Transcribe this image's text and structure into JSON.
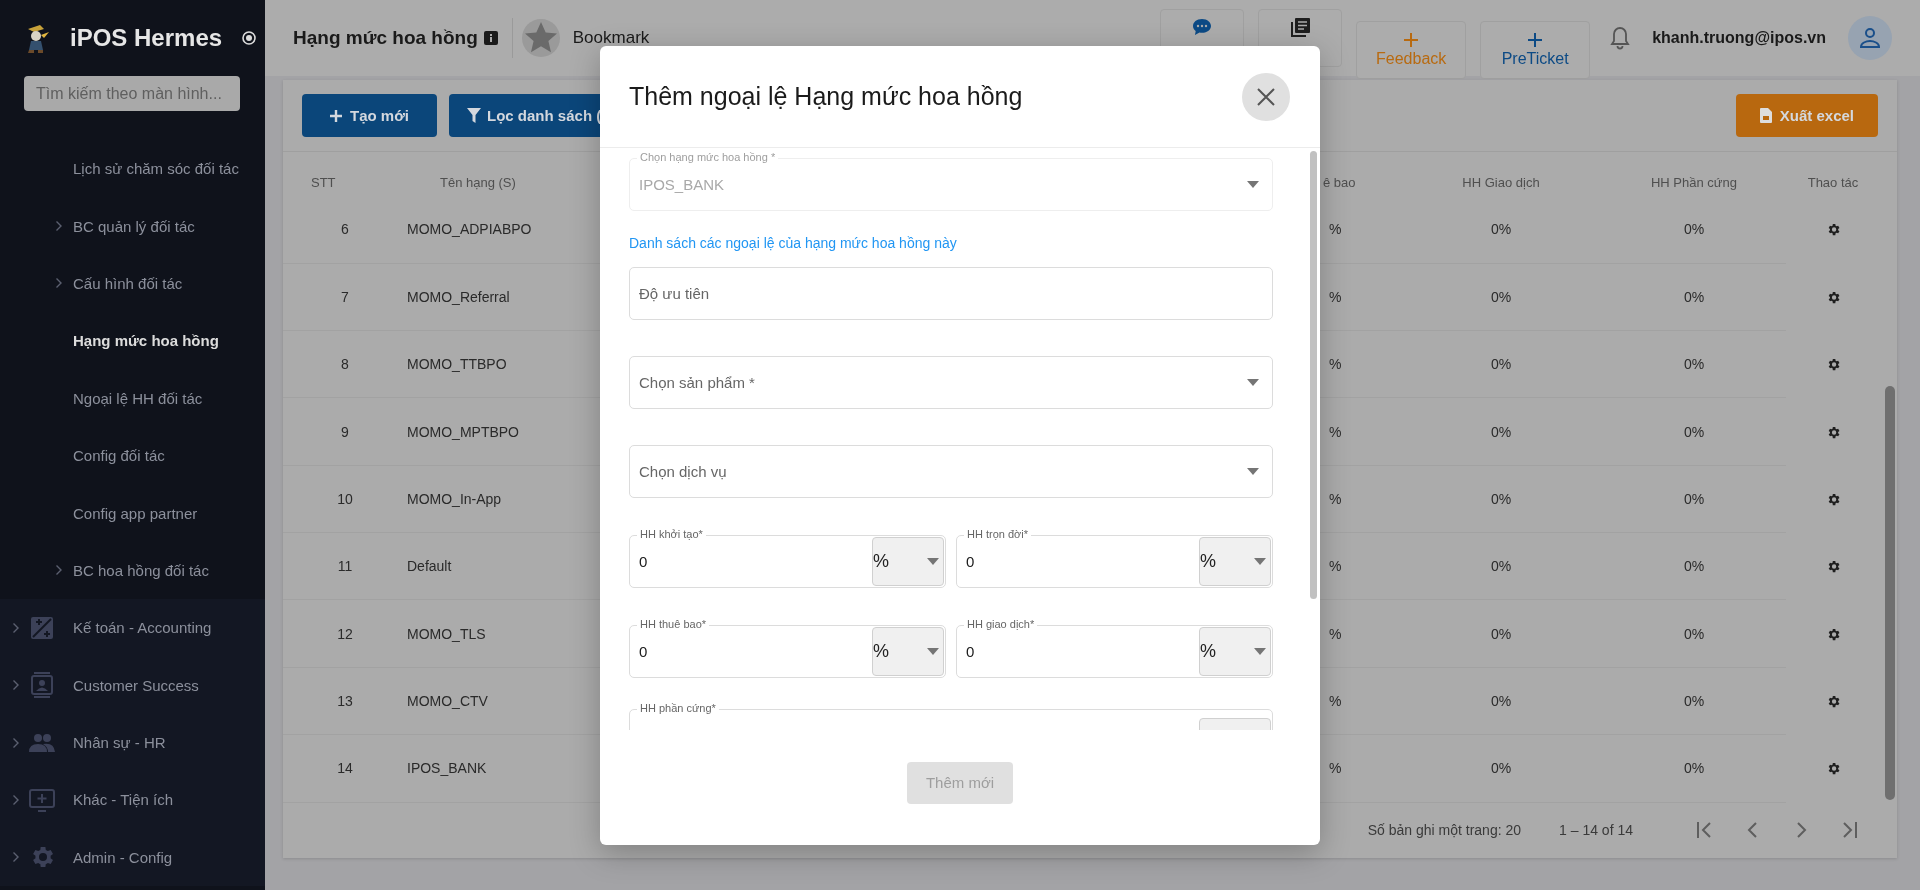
{
  "sidebar": {
    "brand": "iPOS Hermes",
    "search": {
      "placeholder": "Tìm kiếm theo màn hình..."
    },
    "items": [
      {
        "label": "Lịch sử chăm sóc đối tác",
        "kind": "sub",
        "expandable": false,
        "selected": false
      },
      {
        "label": "BC quản lý đối tác",
        "kind": "sub",
        "expandable": true,
        "selected": false
      },
      {
        "label": "Cấu hình đối tác",
        "kind": "sub",
        "expandable": true,
        "selected": false
      },
      {
        "label": "Hạng mức hoa hồng",
        "kind": "sub",
        "expandable": false,
        "selected": true
      },
      {
        "label": "Ngoại lệ HH đối tác",
        "kind": "sub",
        "expandable": false,
        "selected": false
      },
      {
        "label": "Config đối tác",
        "kind": "sub",
        "expandable": false,
        "selected": false
      },
      {
        "label": "Config app partner",
        "kind": "sub",
        "expandable": false,
        "selected": false
      },
      {
        "label": "BC hoa hồng đối tác",
        "kind": "sub",
        "expandable": true,
        "selected": false
      },
      {
        "label": "Kế toán - Accounting",
        "kind": "group",
        "expandable": true,
        "selected": false
      },
      {
        "label": "Customer Success",
        "kind": "group",
        "expandable": true,
        "selected": false
      },
      {
        "label": "Nhân sự - HR",
        "kind": "group",
        "expandable": true,
        "selected": false
      },
      {
        "label": "Khác - Tiện ích",
        "kind": "group",
        "expandable": true,
        "selected": false
      },
      {
        "label": "Admin - Config",
        "kind": "group",
        "expandable": true,
        "selected": false
      }
    ]
  },
  "topbar": {
    "title": "Hạng mức hoa hồng",
    "bookmark": "Bookmark",
    "actions": [
      {
        "color": "#0c4a85"
      },
      {
        "color": "#1e1e1e"
      },
      {
        "label": "Feedback",
        "color": "#b86a10"
      },
      {
        "label": "PreTicket",
        "color": "#0c4a85"
      }
    ],
    "user": "khanh.truong@ipos.vn"
  },
  "toolbar": {
    "create": "Tạo mới",
    "filter": "Lọc danh sách (",
    "export": "Xuất excel"
  },
  "table": {
    "columns": [
      "STT",
      "Tên hạng (S)",
      "ê bao",
      "HH Giao dịch",
      "HH Phần cứng",
      "Thao tác"
    ],
    "rows": [
      [
        "6",
        "MOMO_ADPIABPO",
        "%",
        "0%",
        "0%"
      ],
      [
        "7",
        "MOMO_Referral",
        "%",
        "0%",
        "0%"
      ],
      [
        "8",
        "MOMO_TTBPO",
        "%",
        "0%",
        "0%"
      ],
      [
        "9",
        "MOMO_MPTBPO",
        "%",
        "0%",
        "0%"
      ],
      [
        "10",
        "MOMO_In-App",
        "%",
        "0%",
        "0%"
      ],
      [
        "11",
        "Default",
        "%",
        "0%",
        "0%"
      ],
      [
        "12",
        "MOMO_TLS",
        "%",
        "0%",
        "0%"
      ],
      [
        "13",
        "MOMO_CTV",
        "%",
        "0%",
        "0%"
      ],
      [
        "14",
        "IPOS_BANK",
        "%",
        "0%",
        "0%"
      ]
    ]
  },
  "pagination": {
    "page_size": "Số bản ghi một trang: 20",
    "range": "1 – 14 of 14"
  },
  "modal": {
    "title": "Thêm ngoại lệ Hạng mức hoa hồng",
    "fields": [
      {
        "kind": "select",
        "label": "Chọn hạng mức hoa hồng *",
        "value": "IPOS_BANK",
        "disabled": true
      },
      {
        "kind": "note",
        "text": "Danh sách các ngoại lệ của hạng mức hoa hồng này"
      },
      {
        "kind": "input",
        "placeholder": "Độ ưu tiên"
      },
      {
        "kind": "select",
        "placeholder": "Chọn sản phẩm *",
        "disabled": false
      },
      {
        "kind": "select",
        "placeholder": "Chọn dịch vụ",
        "disabled": false
      },
      {
        "kind": "pair",
        "items": [
          {
            "label": "HH khởi tạo*",
            "value": "0",
            "unit": "%"
          },
          {
            "label": "HH trọn đời*",
            "value": "0",
            "unit": "%"
          }
        ]
      },
      {
        "kind": "pair",
        "items": [
          {
            "label": "HH thuê bao*",
            "value": "0",
            "unit": "%"
          },
          {
            "label": "HH giao dịch*",
            "value": "0",
            "unit": "%"
          }
        ]
      },
      {
        "kind": "wide",
        "label": "HH phần cứng*"
      }
    ],
    "submit": {
      "label": "Thêm mới",
      "disabled": true
    }
  }
}
